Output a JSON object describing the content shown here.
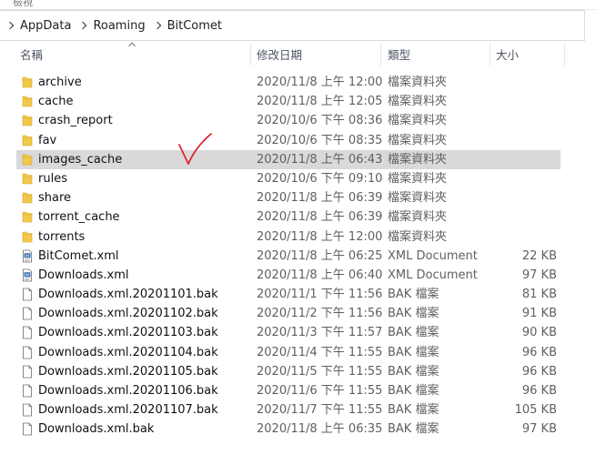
{
  "window": {
    "top_fragment": "檢視"
  },
  "address": {
    "crumbs": [
      "AppData",
      "Roaming",
      "BitComet"
    ]
  },
  "columns": {
    "name": "名稱",
    "date": "修改日期",
    "type": "類型",
    "size": "大小"
  },
  "rows": [
    {
      "name": "archive",
      "date": "2020/11/8 上午 12:00",
      "type": "檔案資料夾",
      "size": "",
      "kind": "folder",
      "selected": false
    },
    {
      "name": "cache",
      "date": "2020/11/8 上午 12:05",
      "type": "檔案資料夾",
      "size": "",
      "kind": "folder",
      "selected": false
    },
    {
      "name": "crash_report",
      "date": "2020/10/6 下午 08:36",
      "type": "檔案資料夾",
      "size": "",
      "kind": "folder",
      "selected": false
    },
    {
      "name": "fav",
      "date": "2020/10/6 下午 08:35",
      "type": "檔案資料夾",
      "size": "",
      "kind": "folder",
      "selected": false
    },
    {
      "name": "images_cache",
      "date": "2020/11/8 上午 06:43",
      "type": "檔案資料夾",
      "size": "",
      "kind": "folder",
      "selected": true
    },
    {
      "name": "rules",
      "date": "2020/10/6 下午 09:10",
      "type": "檔案資料夾",
      "size": "",
      "kind": "folder",
      "selected": false
    },
    {
      "name": "share",
      "date": "2020/11/8 上午 06:39",
      "type": "檔案資料夾",
      "size": "",
      "kind": "folder",
      "selected": false
    },
    {
      "name": "torrent_cache",
      "date": "2020/11/8 上午 06:39",
      "type": "檔案資料夾",
      "size": "",
      "kind": "folder",
      "selected": false
    },
    {
      "name": "torrents",
      "date": "2020/11/8 上午 12:00",
      "type": "檔案資料夾",
      "size": "",
      "kind": "folder",
      "selected": false
    },
    {
      "name": "BitComet.xml",
      "date": "2020/11/8 上午 06:25",
      "type": "XML Document",
      "size": "22 KB",
      "kind": "xml",
      "selected": false
    },
    {
      "name": "Downloads.xml",
      "date": "2020/11/8 上午 06:40",
      "type": "XML Document",
      "size": "97 KB",
      "kind": "xml",
      "selected": false
    },
    {
      "name": "Downloads.xml.20201101.bak",
      "date": "2020/11/1 下午 11:56",
      "type": "BAK 檔案",
      "size": "81 KB",
      "kind": "file",
      "selected": false
    },
    {
      "name": "Downloads.xml.20201102.bak",
      "date": "2020/11/2 下午 11:56",
      "type": "BAK 檔案",
      "size": "91 KB",
      "kind": "file",
      "selected": false
    },
    {
      "name": "Downloads.xml.20201103.bak",
      "date": "2020/11/3 下午 11:57",
      "type": "BAK 檔案",
      "size": "90 KB",
      "kind": "file",
      "selected": false
    },
    {
      "name": "Downloads.xml.20201104.bak",
      "date": "2020/11/4 下午 11:55",
      "type": "BAK 檔案",
      "size": "96 KB",
      "kind": "file",
      "selected": false
    },
    {
      "name": "Downloads.xml.20201105.bak",
      "date": "2020/11/5 下午 11:55",
      "type": "BAK 檔案",
      "size": "96 KB",
      "kind": "file",
      "selected": false
    },
    {
      "name": "Downloads.xml.20201106.bak",
      "date": "2020/11/6 下午 11:55",
      "type": "BAK 檔案",
      "size": "96 KB",
      "kind": "file",
      "selected": false
    },
    {
      "name": "Downloads.xml.20201107.bak",
      "date": "2020/11/7 下午 11:55",
      "type": "BAK 檔案",
      "size": "105 KB",
      "kind": "file",
      "selected": false
    },
    {
      "name": "Downloads.xml.bak",
      "date": "2020/11/8 上午 06:35",
      "type": "BAK 檔案",
      "size": "97 KB",
      "kind": "file",
      "selected": false
    }
  ],
  "colors": {
    "folder": "#f2c94c",
    "folder_dark": "#d9a520",
    "selected_row": "#d9d9d9",
    "annotation": "#e11d2e"
  },
  "icons": {
    "folder": "folder-icon",
    "xml": "xml-file-icon",
    "file": "file-icon",
    "breadcrumb": "chevron-right-icon",
    "sort": "sort-up-icon",
    "annotation": "checkmark-annotation-icon"
  }
}
